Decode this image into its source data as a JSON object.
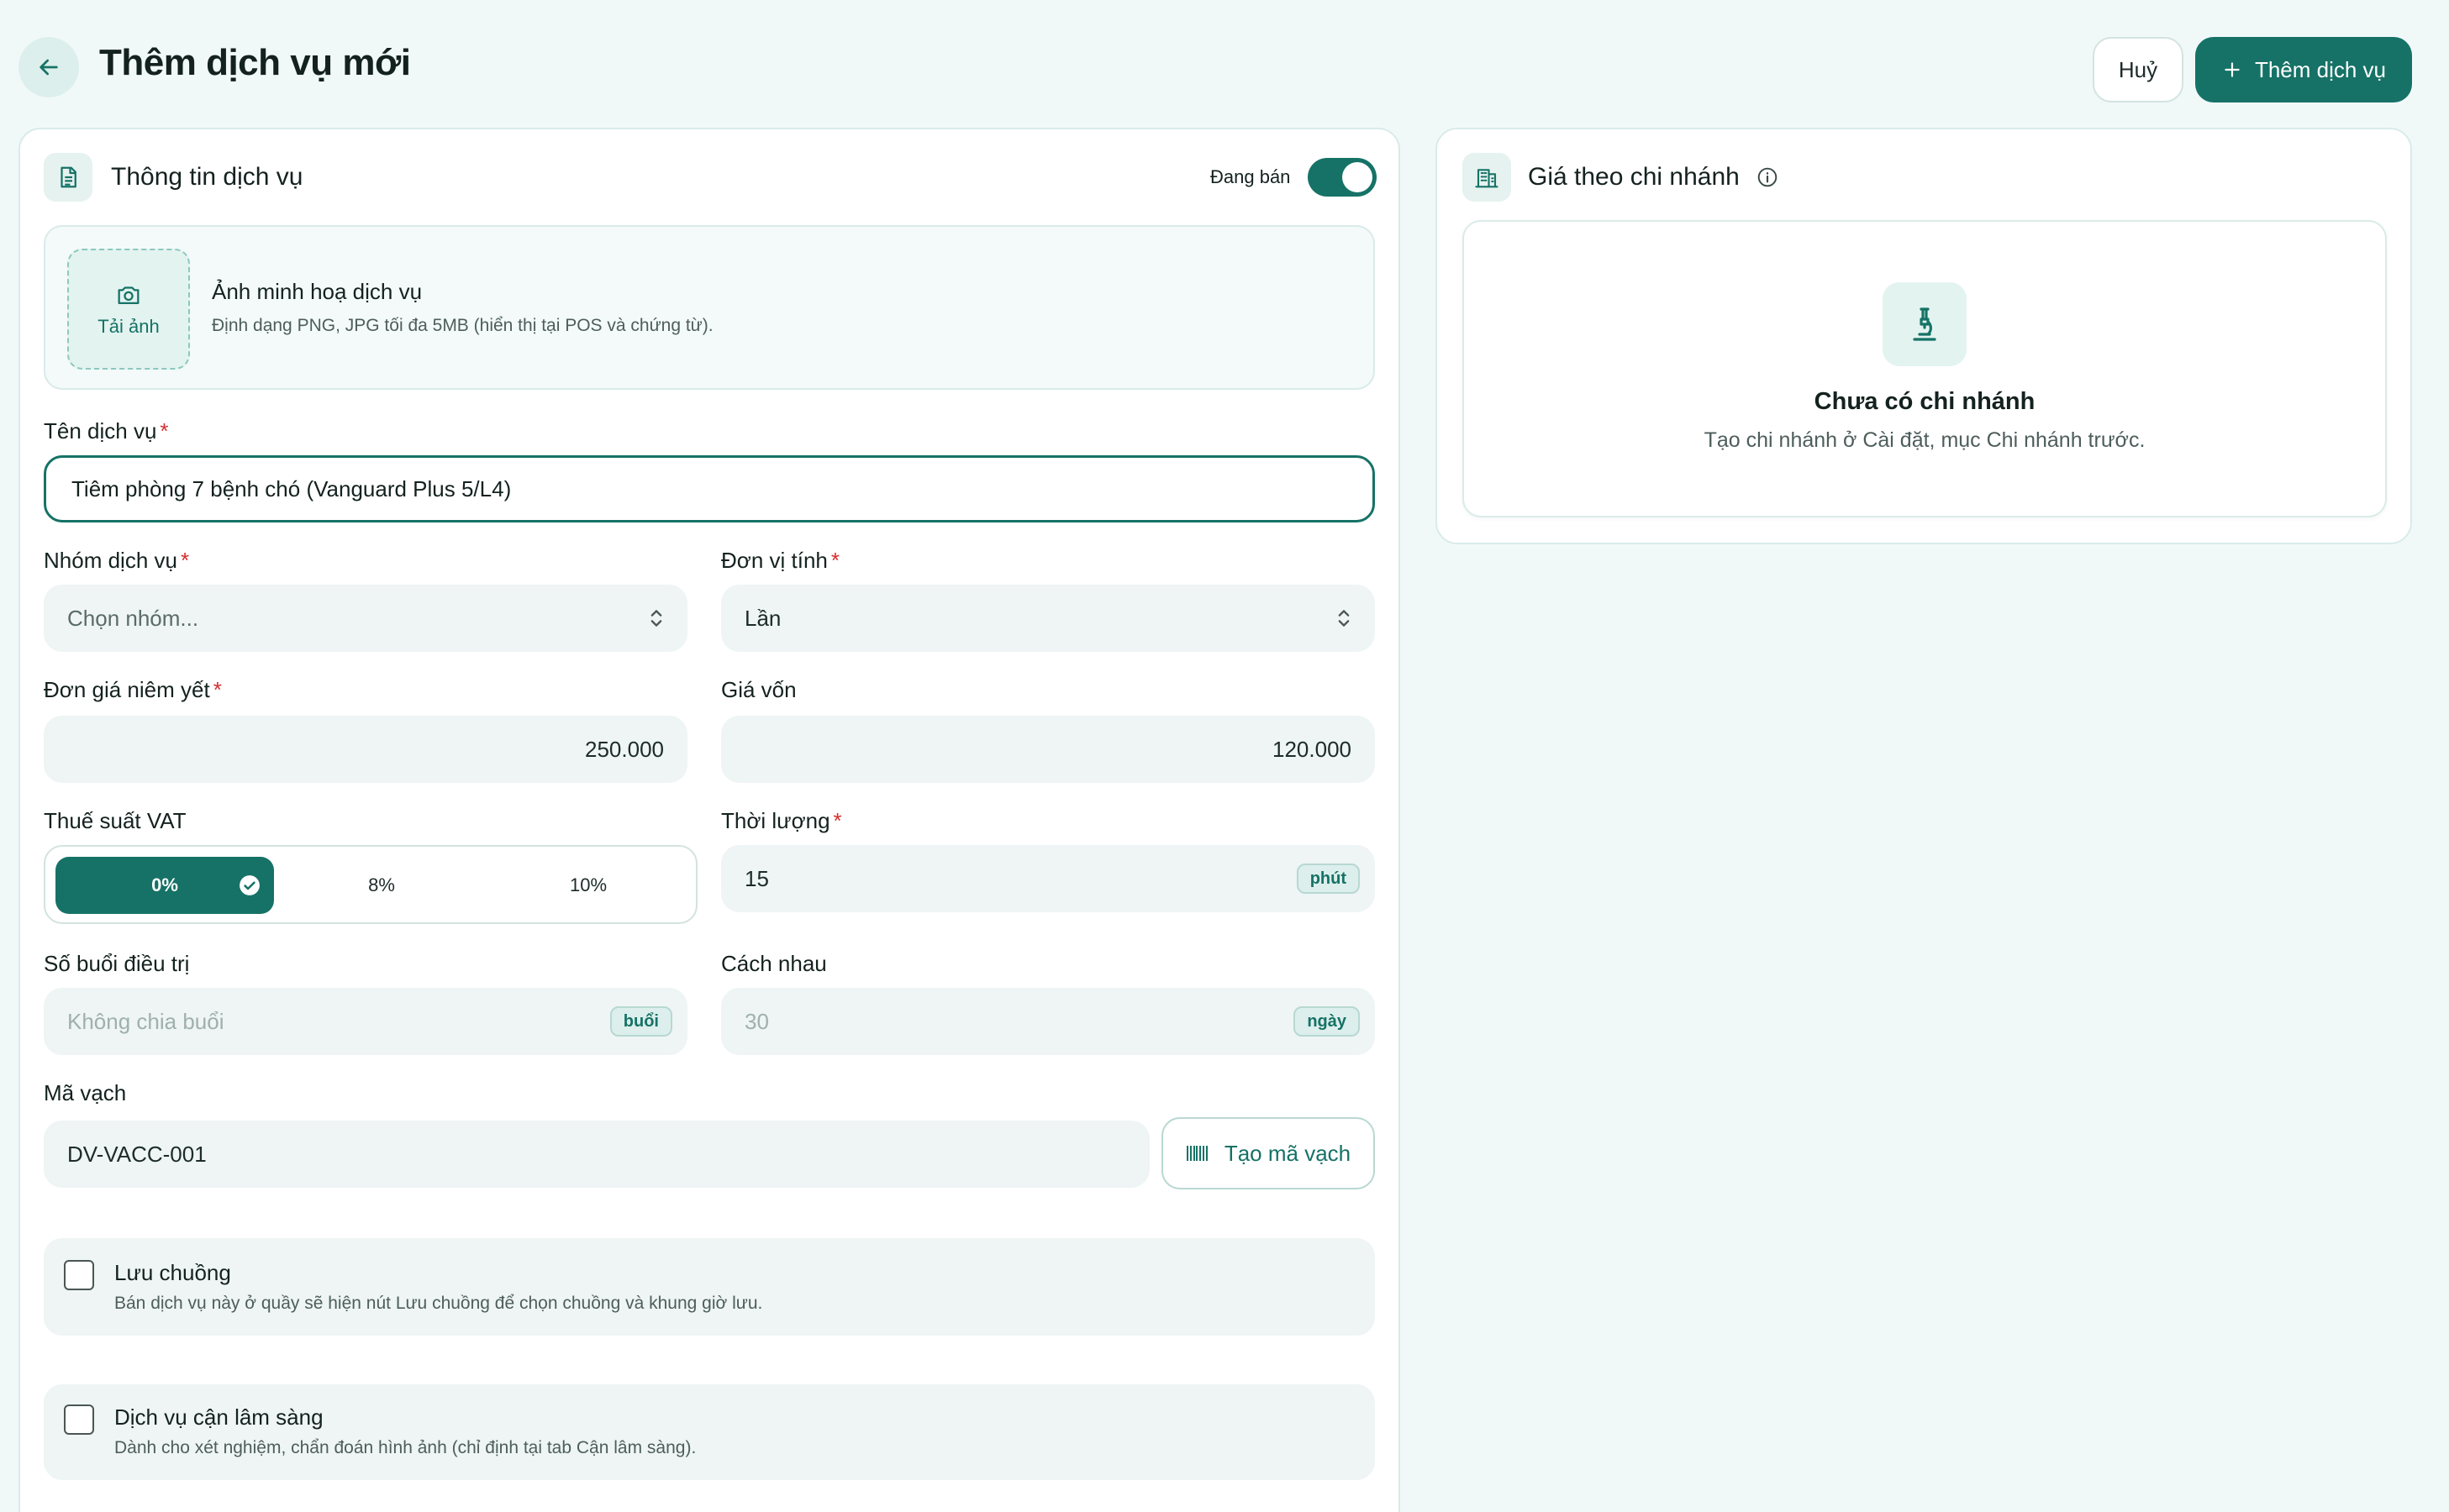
{
  "header": {
    "title": "Thêm dịch vụ mới",
    "cancel_label": "Huỷ",
    "add_label": "Thêm dịch vụ"
  },
  "info_section": {
    "title": "Thông tin dịch vụ",
    "status_label": "Đang bán",
    "status_on": true
  },
  "image_upload": {
    "button_label": "Tải ảnh",
    "title": "Ảnh minh hoạ dịch vụ",
    "hint": "Định dạng PNG, JPG tối đa 5MB (hiển thị tại POS và chứng từ)."
  },
  "form": {
    "name": {
      "label": "Tên dịch vụ",
      "value": "Tiêm phòng 7 bệnh chó (Vanguard Plus 5/L4)"
    },
    "group": {
      "label": "Nhóm dịch vụ",
      "placeholder": "Chọn nhóm..."
    },
    "unit": {
      "label": "Đơn vị tính",
      "value": "Lần"
    },
    "list_price": {
      "label": "Đơn giá niêm yết",
      "value": "250.000"
    },
    "cost_price": {
      "label": "Giá vốn",
      "value": "120.000"
    },
    "vat": {
      "label": "Thuế suất VAT",
      "options": [
        "0%",
        "8%",
        "10%"
      ],
      "selected": "0%"
    },
    "duration": {
      "label": "Thời lượng",
      "value": "15",
      "unit": "phút"
    },
    "sessions": {
      "label": "Số buổi điều trị",
      "placeholder": "Không chia buổi",
      "unit": "buổi"
    },
    "interval": {
      "label": "Cách nhau",
      "placeholder": "30",
      "unit": "ngày"
    },
    "barcode": {
      "label": "Mã vạch",
      "value": "DV-VACC-001",
      "generate_label": "Tạo mã vạch"
    }
  },
  "options": [
    {
      "title": "Lưu chuồng",
      "desc": "Bán dịch vụ này ở quầy sẽ hiện nút Lưu chuồng để chọn chuồng và khung giờ lưu.",
      "checked": false
    },
    {
      "title": "Dịch vụ cận lâm sàng",
      "desc": "Dành cho xét nghiệm, chẩn đoán hình ảnh (chỉ định tại tab Cận lâm sàng).",
      "checked": false
    }
  ],
  "branch_section": {
    "title": "Giá theo chi nhánh",
    "empty_title": "Chưa có chi nhánh",
    "empty_desc": "Tạo chi nhánh ở Cài đặt, mục Chi nhánh trước."
  },
  "colors": {
    "accent": "#167266",
    "background": "#f1f9f8",
    "field": "#eef5f4",
    "required": "#d32f2f"
  }
}
